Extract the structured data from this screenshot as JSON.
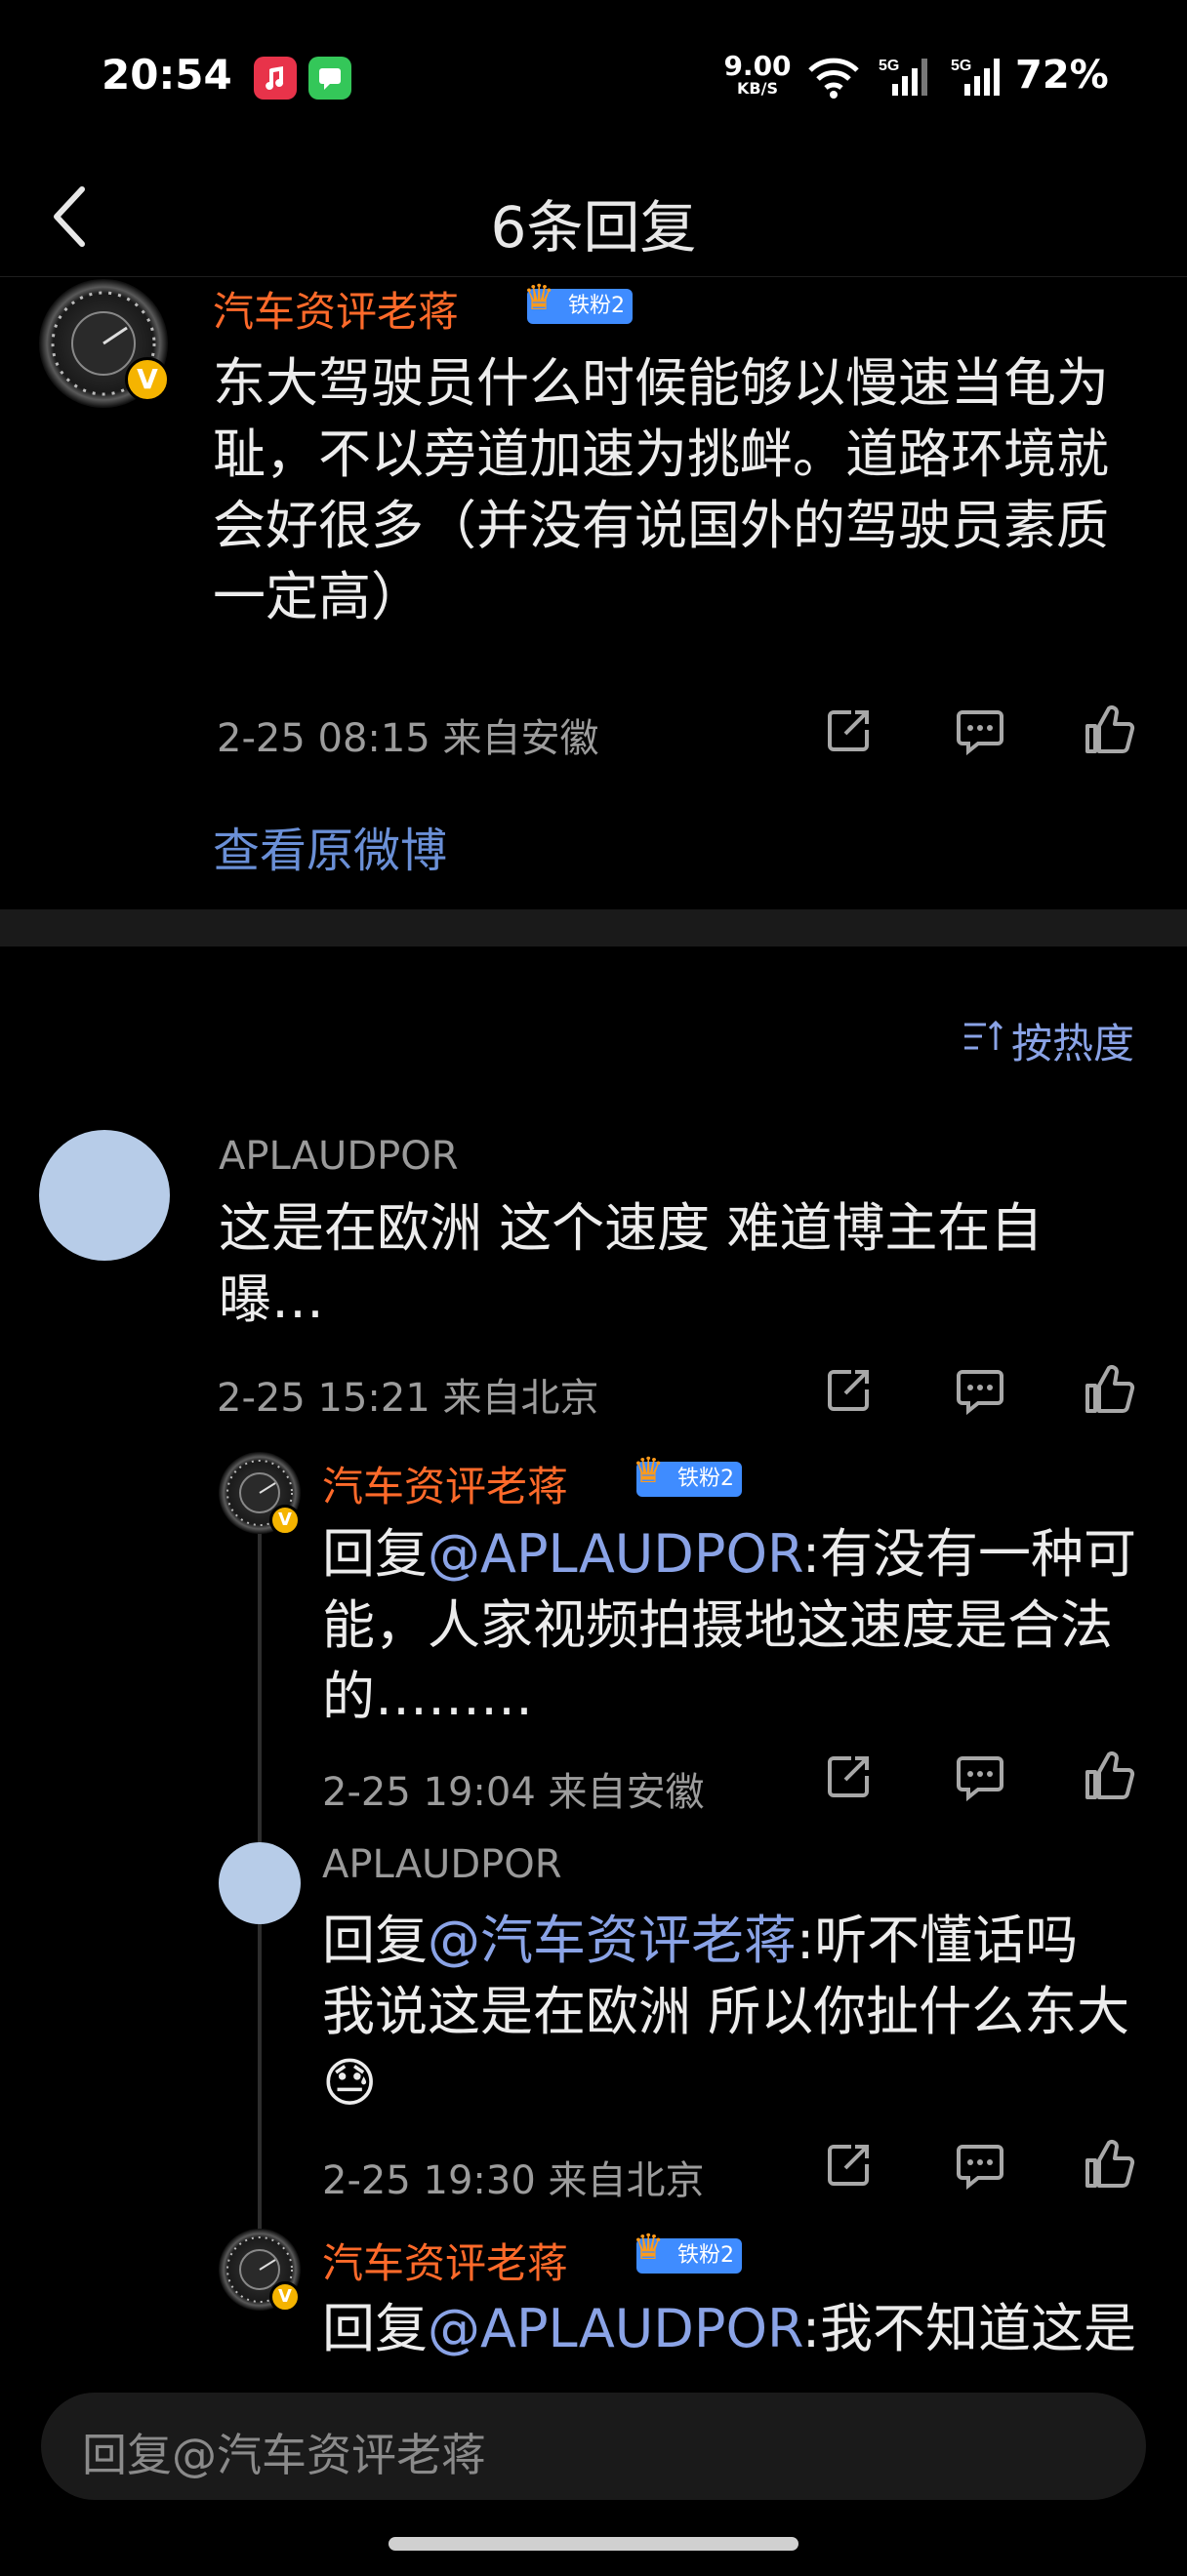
{
  "status_bar": {
    "time": "20:54",
    "net_speed_value": "9.00",
    "net_speed_unit": "KB/S",
    "signal1_label": "5G",
    "signal2_label": "5G",
    "battery": "72%"
  },
  "nav": {
    "title": "6条回复"
  },
  "top_post": {
    "username": "汽车资评老蒋",
    "fan_badge": "铁粉2",
    "text": "东大驾驶员什么时候能够以慢速当龟为耻，不以旁道加速为挑衅。道路环境就会好很多（并没有说国外的驾驶员素质一定高）",
    "meta": "2-25 08:15  来自安徽",
    "view_original": "查看原微博"
  },
  "sort_label": "按热度",
  "comments": [
    {
      "username": "APLAUDPOR",
      "text": "这是在欧洲 这个速度 难道博主在自曝…",
      "meta": "2-25 15:21  来自北京"
    },
    {
      "username": "汽车资评老蒋",
      "fan_badge": "铁粉2",
      "reply_prefix": "回复",
      "mention": "@APLAUDPOR",
      "text": ":有没有一种可能，人家视频拍摄地这速度是合法的………",
      "meta": "2-25 19:04  来自安徽"
    },
    {
      "username": "APLAUDPOR",
      "reply_prefix": "回复",
      "mention": "@汽车资评老蒋",
      "text": ":听不懂话吗 我说这是在欧洲 所以你扯什么东大😓",
      "meta": "2-25 19:30  来自北京"
    },
    {
      "username": "汽车资评老蒋",
      "fan_badge": "铁粉2",
      "reply_prefix": "回复",
      "mention": "@APLAUDPOR",
      "text": ":我不知道这是"
    }
  ],
  "reply_input": {
    "placeholder": "回复@汽车资评老蒋"
  },
  "colors": {
    "background": "#000000",
    "username_orange": "#ff6a2a",
    "link_blue": "#8aa3e6",
    "fan_badge_blue": "#3f8cff"
  },
  "icons": [
    "back-chevron-icon",
    "repost-icon",
    "comment-icon",
    "like-icon",
    "sort-icon",
    "verified-badge-icon",
    "crown-icon"
  ]
}
